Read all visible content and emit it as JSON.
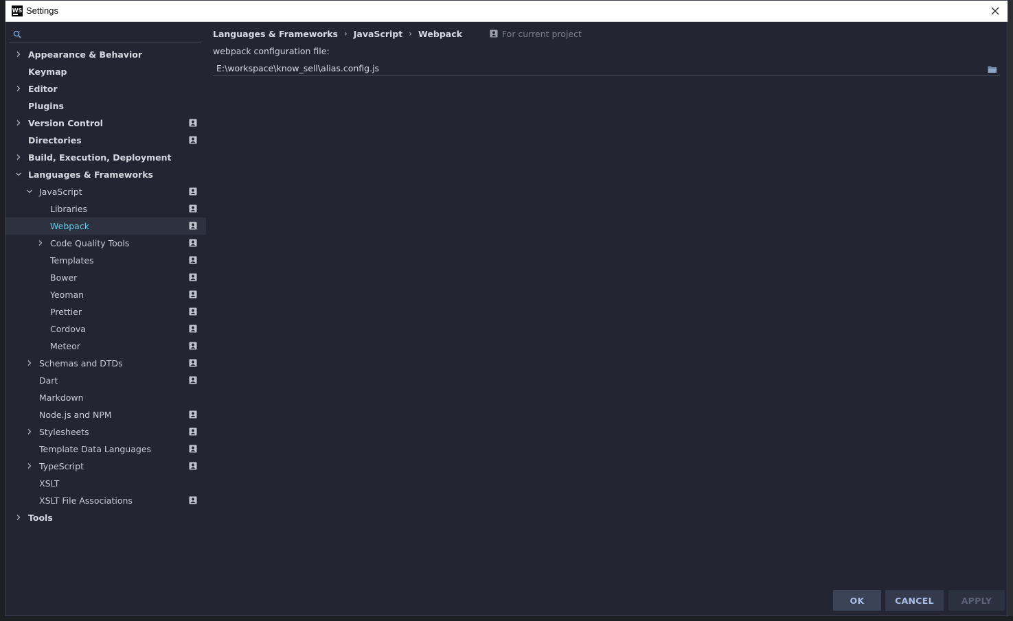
{
  "window": {
    "title": "Settings"
  },
  "sidebar": {
    "search": {
      "value": "",
      "placeholder": ""
    },
    "items": [
      {
        "label": "Appearance & Behavior",
        "level": 0,
        "expandable": true,
        "expanded": false,
        "bold": true,
        "project": false
      },
      {
        "label": "Keymap",
        "level": 0,
        "expandable": false,
        "bold": true,
        "project": false
      },
      {
        "label": "Editor",
        "level": 0,
        "expandable": true,
        "expanded": false,
        "bold": true,
        "project": false
      },
      {
        "label": "Plugins",
        "level": 0,
        "expandable": false,
        "bold": true,
        "project": false
      },
      {
        "label": "Version Control",
        "level": 0,
        "expandable": true,
        "expanded": false,
        "bold": true,
        "project": true
      },
      {
        "label": "Directories",
        "level": 0,
        "expandable": false,
        "bold": true,
        "project": true
      },
      {
        "label": "Build, Execution, Deployment",
        "level": 0,
        "expandable": true,
        "expanded": false,
        "bold": true,
        "project": false
      },
      {
        "label": "Languages & Frameworks",
        "level": 0,
        "expandable": true,
        "expanded": true,
        "bold": true,
        "project": false
      },
      {
        "label": "JavaScript",
        "level": 1,
        "expandable": true,
        "expanded": true,
        "bold": false,
        "project": true
      },
      {
        "label": "Libraries",
        "level": 2,
        "expandable": false,
        "bold": false,
        "project": true
      },
      {
        "label": "Webpack",
        "level": 2,
        "expandable": false,
        "bold": false,
        "project": true,
        "selected": true
      },
      {
        "label": "Code Quality Tools",
        "level": 2,
        "expandable": true,
        "expanded": false,
        "bold": false,
        "project": true
      },
      {
        "label": "Templates",
        "level": 2,
        "expandable": false,
        "bold": false,
        "project": true
      },
      {
        "label": "Bower",
        "level": 2,
        "expandable": false,
        "bold": false,
        "project": true
      },
      {
        "label": "Yeoman",
        "level": 2,
        "expandable": false,
        "bold": false,
        "project": true
      },
      {
        "label": "Prettier",
        "level": 2,
        "expandable": false,
        "bold": false,
        "project": true
      },
      {
        "label": "Cordova",
        "level": 2,
        "expandable": false,
        "bold": false,
        "project": true
      },
      {
        "label": "Meteor",
        "level": 2,
        "expandable": false,
        "bold": false,
        "project": true
      },
      {
        "label": "Schemas and DTDs",
        "level": 1,
        "expandable": true,
        "expanded": false,
        "bold": false,
        "project": true
      },
      {
        "label": "Dart",
        "level": 1,
        "expandable": false,
        "bold": false,
        "project": true
      },
      {
        "label": "Markdown",
        "level": 1,
        "expandable": false,
        "bold": false,
        "project": false
      },
      {
        "label": "Node.js and NPM",
        "level": 1,
        "expandable": false,
        "bold": false,
        "project": true
      },
      {
        "label": "Stylesheets",
        "level": 1,
        "expandable": true,
        "expanded": false,
        "bold": false,
        "project": true
      },
      {
        "label": "Template Data Languages",
        "level": 1,
        "expandable": false,
        "bold": false,
        "project": true
      },
      {
        "label": "TypeScript",
        "level": 1,
        "expandable": true,
        "expanded": false,
        "bold": false,
        "project": true
      },
      {
        "label": "XSLT",
        "level": 1,
        "expandable": false,
        "bold": false,
        "project": false
      },
      {
        "label": "XSLT File Associations",
        "level": 1,
        "expandable": false,
        "bold": false,
        "project": true
      },
      {
        "label": "Tools",
        "level": 0,
        "expandable": true,
        "expanded": false,
        "bold": true,
        "project": false
      }
    ]
  },
  "breadcrumb": {
    "items": [
      "Languages & Frameworks",
      "JavaScript",
      "Webpack"
    ],
    "separator": "›",
    "scope_label": "For current project"
  },
  "webpack": {
    "config_label": "webpack configuration file:",
    "config_path": "E:\\workspace\\know_sell\\alias.config.js"
  },
  "buttons": {
    "ok": "OK",
    "cancel": "CANCEL",
    "apply": "APPLY"
  },
  "colors": {
    "background": "#232632",
    "selected_row": "#2e3240",
    "selected_text": "#64c8e6",
    "text": "#c8ccd6",
    "muted": "#7c808b"
  },
  "icons": {
    "search": "search-icon",
    "close": "close-icon",
    "project_scope": "project-scope-icon",
    "folder": "folder-icon",
    "help": "help-icon",
    "chevron_right": "chevron-right-icon",
    "chevron_down": "chevron-down-icon"
  }
}
